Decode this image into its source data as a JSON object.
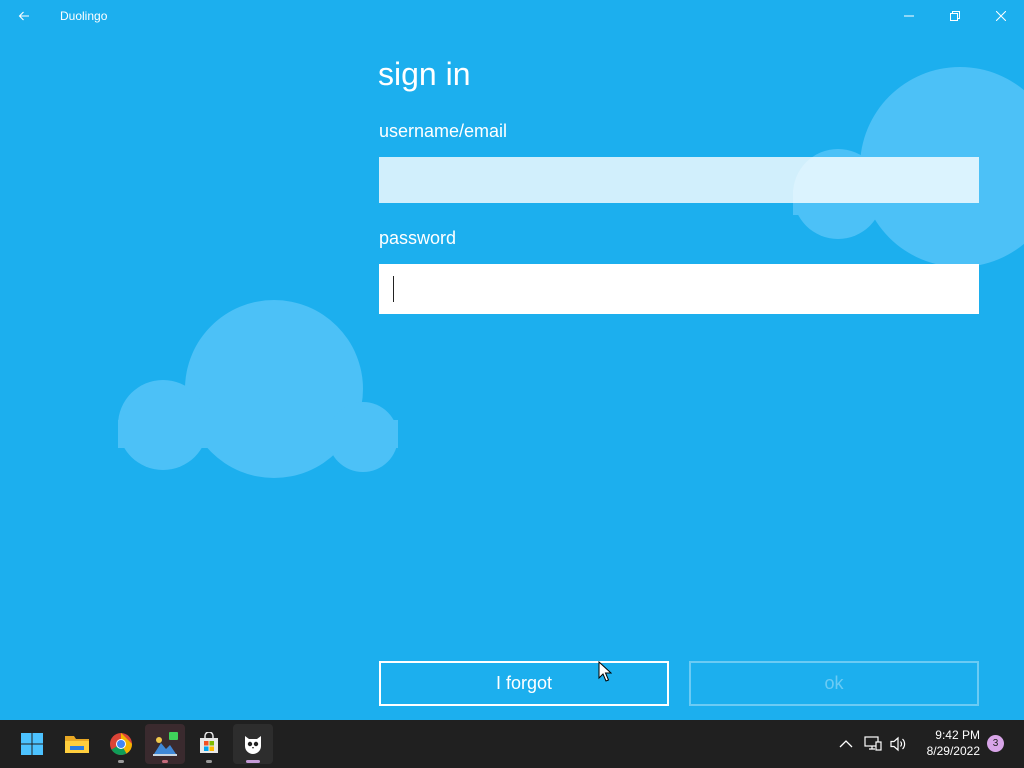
{
  "window": {
    "title": "Duolingo"
  },
  "form": {
    "heading": "sign in",
    "username_label": "username/email",
    "username_value": "",
    "password_label": "password",
    "password_value": ""
  },
  "buttons": {
    "forgot_label": "I forgot",
    "ok_label": "ok"
  },
  "taskbar": {
    "apps": [
      "start-icon",
      "file-explorer-icon",
      "chrome-icon",
      "photos-icon",
      "microsoft-store-icon",
      "duolingo-icon"
    ],
    "active_app": "duolingo-icon",
    "time": "9:42 PM",
    "date": "8/29/2022",
    "notification_count": "3"
  },
  "colors": {
    "background": "#1cafee",
    "cloud": "#4cc1f7",
    "taskbar": "#202020"
  }
}
